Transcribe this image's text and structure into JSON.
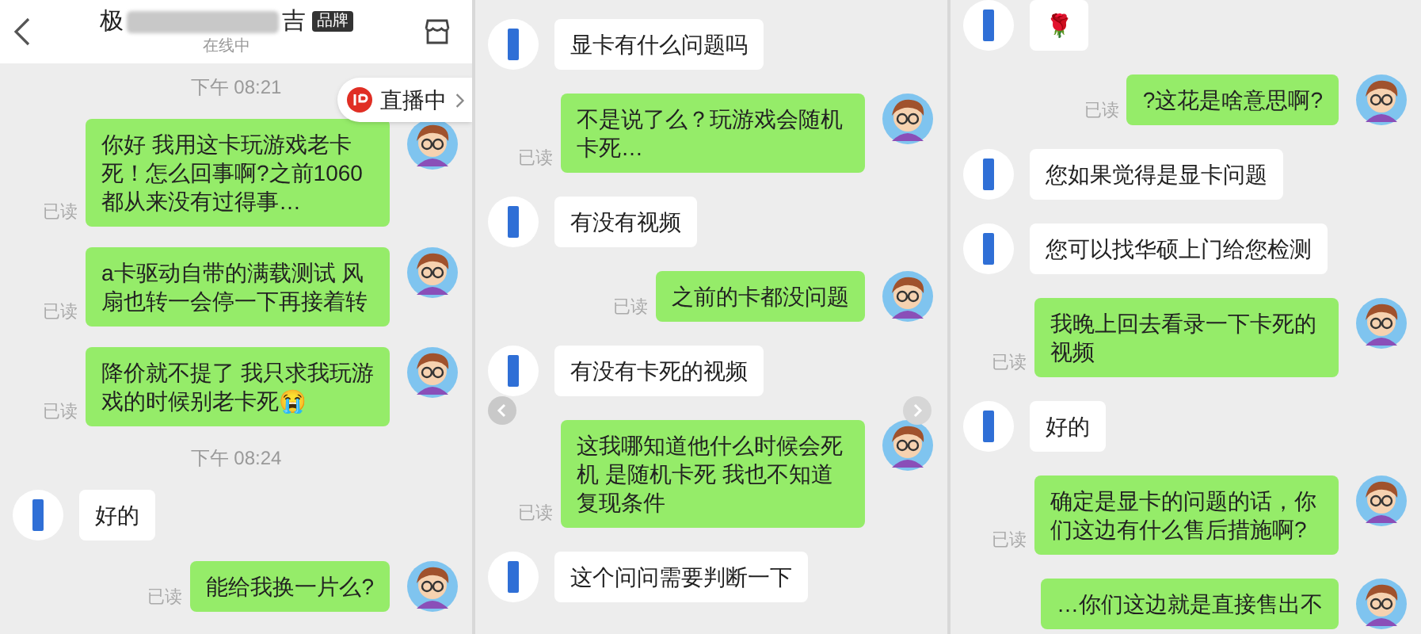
{
  "panels": [
    {
      "header": {
        "title_start": "极",
        "title_end": "吉",
        "badge": "品牌",
        "subtitle": "在线中"
      },
      "live_pill": {
        "label": "直播中"
      },
      "messages": [
        {
          "kind": "time",
          "text": "下午 08:21"
        },
        {
          "kind": "sent",
          "text": "你好 我用这卡玩游戏老卡死！怎么回事啊?之前1060都从来没有过得事…",
          "read_label": "已读"
        },
        {
          "kind": "sent",
          "text": "a卡驱动自带的满载测试 风扇也转一会停一下再接着转",
          "read_label": "已读"
        },
        {
          "kind": "sent",
          "text": "降价就不提了  我只求我玩游戏的时候别老卡死😭",
          "read_label": "已读"
        },
        {
          "kind": "time",
          "text": "下午 08:24"
        },
        {
          "kind": "received",
          "text": "好的"
        },
        {
          "kind": "sent",
          "text": "能给我换一片么?",
          "read_label": "已读"
        }
      ]
    },
    {
      "nav_arrows": true,
      "messages": [
        {
          "kind": "received",
          "text": "显卡有什么问题吗"
        },
        {
          "kind": "sent",
          "text": "不是说了么？玩游戏会随机卡死…",
          "read_label": "已读"
        },
        {
          "kind": "received",
          "text": "有没有视频"
        },
        {
          "kind": "sent",
          "text": "之前的卡都没问题",
          "read_label": "已读"
        },
        {
          "kind": "received",
          "text": "有没有卡死的视频"
        },
        {
          "kind": "sent",
          "text": "这我哪知道他什么时候会死机  是随机卡死 我也不知道复现条件",
          "read_label": "已读"
        },
        {
          "kind": "received",
          "text": "这个问问需要判断一下"
        }
      ]
    },
    {
      "messages": [
        {
          "kind": "received",
          "text": "🌹"
        },
        {
          "kind": "sent",
          "text": "?这花是啥意思啊?",
          "read_label": "已读"
        },
        {
          "kind": "received",
          "text": "您如果觉得是显卡问题"
        },
        {
          "kind": "received",
          "text": "您可以找华硕上门给您检测"
        },
        {
          "kind": "sent",
          "text": "我晚上回去看录一下卡死的视频",
          "read_label": "已读"
        },
        {
          "kind": "received",
          "text": "好的"
        },
        {
          "kind": "sent",
          "text": "确定是显卡的问题的话，你们这边有什么售后措施啊?",
          "read_label": "已读"
        },
        {
          "kind": "sent",
          "text": "…你们这边就是直接售出不"
        }
      ]
    }
  ]
}
